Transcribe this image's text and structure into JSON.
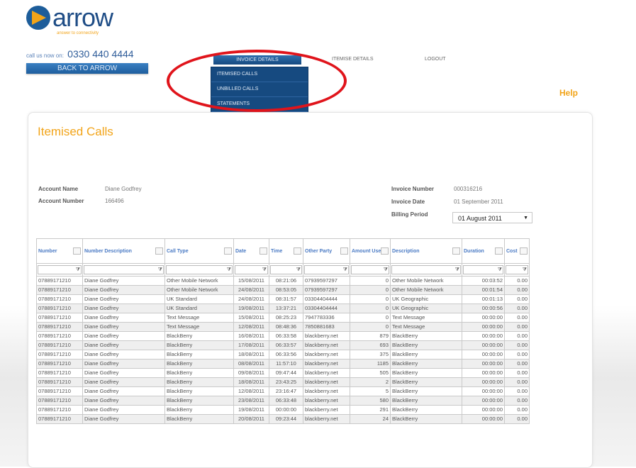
{
  "brand": {
    "logo_text": "arrow",
    "tagline": "answer to connectivity"
  },
  "header": {
    "call_label": "call us now on:",
    "phone": "0330 440 4444",
    "back_button": "BACK TO ARROW",
    "nav_invoice": "INVOICE DETAILS",
    "nav_other": "ITEMISE DETAILS",
    "nav_logout": "LOGOUT",
    "dropdown": [
      "ITEMISED CALLS",
      "UNBILLED CALLS",
      "STATEMENTS"
    ],
    "help": "Help"
  },
  "page": {
    "title": "Itemised Calls",
    "account_name_label": "Account Name",
    "account_name": "Diane Godfrey",
    "account_number_label": "Account Number",
    "account_number": "166496",
    "invoice_number_label": "Invoice Number",
    "invoice_number": "000316216",
    "invoice_date_label": "Invoice Date",
    "invoice_date": "01 September 2011",
    "billing_period_label": "Billing Period",
    "billing_period": "01 August 2011"
  },
  "colors": {
    "accent": "#f2a419",
    "brand": "#1f4d86",
    "highlight_circle": "#e0141b"
  },
  "table": {
    "columns": [
      "Number",
      "Number Description",
      "Call Type",
      "Date",
      "Time",
      "Other Party",
      "Amount Used",
      "Description",
      "Duration",
      "Cost"
    ],
    "rows": [
      [
        "07889171210",
        "Diane Godfrey",
        "Other Mobile Network",
        "15/08/2011",
        "08:21:06",
        "07939597297",
        "0",
        "Other Mobile Network",
        "00:03:52",
        "0.00"
      ],
      [
        "07889171210",
        "Diane Godfrey",
        "Other Mobile Network",
        "24/08/2011",
        "08:53:05",
        "07939597297",
        "0",
        "Other Mobile Network",
        "00:01:54",
        "0.00"
      ],
      [
        "07889171210",
        "Diane Godfrey",
        "UK Standard",
        "24/08/2011",
        "08:31:57",
        "03304404444",
        "0",
        "UK Geographic",
        "00:01:13",
        "0.00"
      ],
      [
        "07889171210",
        "Diane Godfrey",
        "UK Standard",
        "19/08/2011",
        "13:37:21",
        "03304404444",
        "0",
        "UK Geographic",
        "00:00:56",
        "0.00"
      ],
      [
        "07889171210",
        "Diane Godfrey",
        "Text Message",
        "15/08/2011",
        "08:25:23",
        "7947783336",
        "0",
        "Text Message",
        "00:00:00",
        "0.00"
      ],
      [
        "07889171210",
        "Diane Godfrey",
        "Text Message",
        "12/08/2011",
        "08:48:36",
        "7850881683",
        "0",
        "Text Message",
        "00:00:00",
        "0.00"
      ],
      [
        "07889171210",
        "Diane Godfrey",
        "BlackBerry",
        "16/08/2011",
        "06:33:58",
        "blackberry.net",
        "879",
        "BlackBerry",
        "00:00:00",
        "0.00"
      ],
      [
        "07889171210",
        "Diane Godfrey",
        "BlackBerry",
        "17/08/2011",
        "06:33:57",
        "blackberry.net",
        "693",
        "BlackBerry",
        "00:00:00",
        "0.00"
      ],
      [
        "07889171210",
        "Diane Godfrey",
        "BlackBerry",
        "18/08/2011",
        "06:33:56",
        "blackberry.net",
        "375",
        "BlackBerry",
        "00:00:00",
        "0.00"
      ],
      [
        "07889171210",
        "Diane Godfrey",
        "BlackBerry",
        "08/08/2011",
        "11:57:10",
        "blackberry.net",
        "1185",
        "BlackBerry",
        "00:00:00",
        "0.00"
      ],
      [
        "07889171210",
        "Diane Godfrey",
        "BlackBerry",
        "09/08/2011",
        "09:47:44",
        "blackberry.net",
        "505",
        "BlackBerry",
        "00:00:00",
        "0.00"
      ],
      [
        "07889171210",
        "Diane Godfrey",
        "BlackBerry",
        "18/08/2011",
        "23:43:25",
        "blackberry.net",
        "2",
        "BlackBerry",
        "00:00:00",
        "0.00"
      ],
      [
        "07889171210",
        "Diane Godfrey",
        "BlackBerry",
        "12/08/2011",
        "23:16:47",
        "blackberry.net",
        "5",
        "BlackBerry",
        "00:00:00",
        "0.00"
      ],
      [
        "07889171210",
        "Diane Godfrey",
        "BlackBerry",
        "23/08/2011",
        "06:33:48",
        "blackberry.net",
        "580",
        "BlackBerry",
        "00:00:00",
        "0.00"
      ],
      [
        "07889171210",
        "Diane Godfrey",
        "BlackBerry",
        "19/08/2011",
        "00:00:00",
        "blackberry.net",
        "291",
        "BlackBerry",
        "00:00:00",
        "0.00"
      ],
      [
        "07889171210",
        "Diane Godfrey",
        "BlackBerry",
        "20/08/2011",
        "09:23:44",
        "blackberry.net",
        "24",
        "BlackBerry",
        "00:00:00",
        "0.00"
      ]
    ]
  }
}
